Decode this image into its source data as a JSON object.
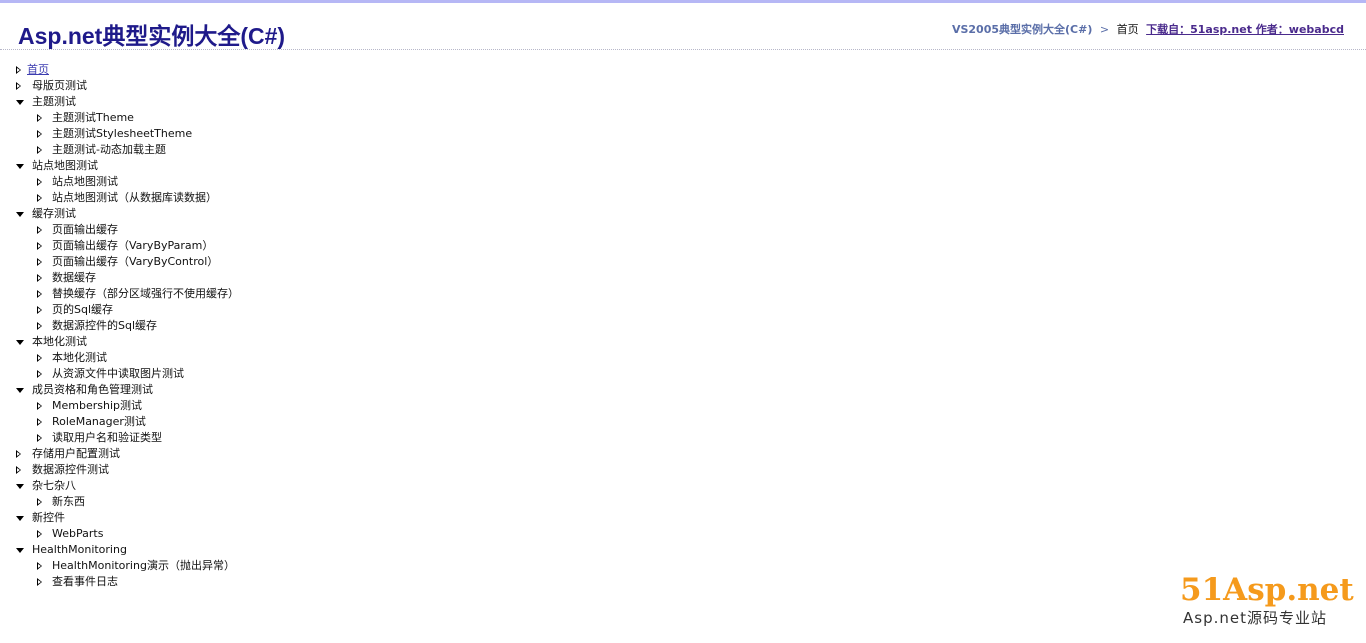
{
  "header": {
    "title": "Asp.net典型实例大全(C#)",
    "breadcrumb": {
      "root": "VS2005典型实例大全(C#)",
      "separator": ">",
      "current": "首页",
      "download": "下载自：51asp.net 作者：webabcd"
    }
  },
  "tree": [
    {
      "label": "首页",
      "level": 0,
      "state": "collapsed",
      "link": true
    },
    {
      "label": "母版页测试",
      "level": 0,
      "state": "collapsed"
    },
    {
      "label": "主题测试",
      "level": 0,
      "state": "expanded"
    },
    {
      "label": "主题测试Theme",
      "level": 1,
      "state": "collapsed"
    },
    {
      "label": "主题测试StylesheetTheme",
      "level": 1,
      "state": "collapsed"
    },
    {
      "label": "主题测试-动态加载主题",
      "level": 1,
      "state": "collapsed"
    },
    {
      "label": "站点地图测试",
      "level": 0,
      "state": "expanded"
    },
    {
      "label": "站点地图测试",
      "level": 1,
      "state": "collapsed"
    },
    {
      "label": "站点地图测试（从数据库读数据）",
      "level": 1,
      "state": "collapsed"
    },
    {
      "label": "缓存测试",
      "level": 0,
      "state": "expanded"
    },
    {
      "label": "页面输出缓存",
      "level": 1,
      "state": "collapsed"
    },
    {
      "label": "页面输出缓存（VaryByParam）",
      "level": 1,
      "state": "collapsed"
    },
    {
      "label": "页面输出缓存（VaryByControl）",
      "level": 1,
      "state": "collapsed"
    },
    {
      "label": "数据缓存",
      "level": 1,
      "state": "collapsed"
    },
    {
      "label": "替换缓存（部分区域强行不使用缓存）",
      "level": 1,
      "state": "collapsed"
    },
    {
      "label": "页的Sql缓存",
      "level": 1,
      "state": "collapsed"
    },
    {
      "label": "数据源控件的Sql缓存",
      "level": 1,
      "state": "collapsed"
    },
    {
      "label": "本地化测试",
      "level": 0,
      "state": "expanded"
    },
    {
      "label": "本地化测试",
      "level": 1,
      "state": "collapsed"
    },
    {
      "label": "从资源文件中读取图片测试",
      "level": 1,
      "state": "collapsed"
    },
    {
      "label": "成员资格和角色管理测试",
      "level": 0,
      "state": "expanded"
    },
    {
      "label": "Membership测试",
      "level": 1,
      "state": "collapsed"
    },
    {
      "label": "RoleManager测试",
      "level": 1,
      "state": "collapsed"
    },
    {
      "label": "读取用户名和验证类型",
      "level": 1,
      "state": "collapsed"
    },
    {
      "label": "存储用户配置测试",
      "level": 0,
      "state": "collapsed"
    },
    {
      "label": "数据源控件测试",
      "level": 0,
      "state": "collapsed"
    },
    {
      "label": "杂七杂八",
      "level": 0,
      "state": "expanded"
    },
    {
      "label": "新东西",
      "level": 1,
      "state": "collapsed"
    },
    {
      "label": "新控件",
      "level": 0,
      "state": "expanded"
    },
    {
      "label": "WebParts",
      "level": 1,
      "state": "collapsed"
    },
    {
      "label": "HealthMonitoring",
      "level": 0,
      "state": "expanded"
    },
    {
      "label": "HealthMonitoring演示（抛出异常）",
      "level": 1,
      "state": "collapsed"
    },
    {
      "label": "查看事件日志",
      "level": 1,
      "state": "collapsed"
    }
  ],
  "logo": {
    "main": "51Asp.net",
    "sub": "Asp.net源码专业站"
  },
  "colors": {
    "title": "#1f1a8a",
    "top_bar": "#b6b7f5",
    "breadcrumb_link": "#5a6ea8",
    "logo": "#f59a1c"
  }
}
